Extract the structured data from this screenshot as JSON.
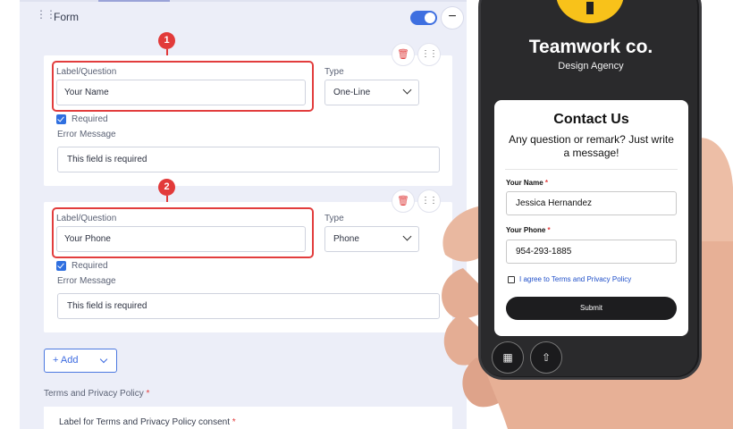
{
  "form_header": {
    "title": "Form",
    "collapse_symbol": "−"
  },
  "fields": [
    {
      "label_caption": "Label/Question",
      "label_value": "Your Name",
      "type_caption": "Type",
      "type_value": "One-Line",
      "required_label": "Required",
      "error_caption": "Error Message",
      "error_value": "This field is required",
      "badge": "1"
    },
    {
      "label_caption": "Label/Question",
      "label_value": "Your Phone",
      "type_caption": "Type",
      "type_value": "Phone",
      "required_label": "Required",
      "error_caption": "Error Message",
      "error_value": "This field is required",
      "badge": "2"
    }
  ],
  "add_button": {
    "label": "Add",
    "plus": "+"
  },
  "terms": {
    "title": "Terms and Privacy Policy",
    "consent_label": "Label for Terms and Privacy Policy consent",
    "required_marker": "*"
  },
  "phone_preview": {
    "brand": "Teamwork co.",
    "tagline": "Design Agency",
    "contact_title": "Contact Us",
    "contact_subtitle": "Any question or remark? Just write a message!",
    "name_label": "Your Name",
    "name_value": "Jessica Hernandez",
    "phone_label": "Your Phone",
    "phone_value": "954-293-1885",
    "required_marker": "*",
    "terms_text": "I agree to Terms and Privacy Policy",
    "submit_label": "Submit"
  },
  "colors": {
    "accent_blue": "#3e6fe0",
    "annotation_red": "#e23d3d",
    "logo_yellow": "#f8c21a",
    "panel_bg": "#eceef8"
  },
  "icons": [
    "drag-handle-icon",
    "toggle-switch",
    "minus-icon",
    "trash-icon",
    "grip-icon",
    "checkbox-icon",
    "chevron-down-icon",
    "plus-icon",
    "qr-code-icon",
    "share-icon"
  ]
}
